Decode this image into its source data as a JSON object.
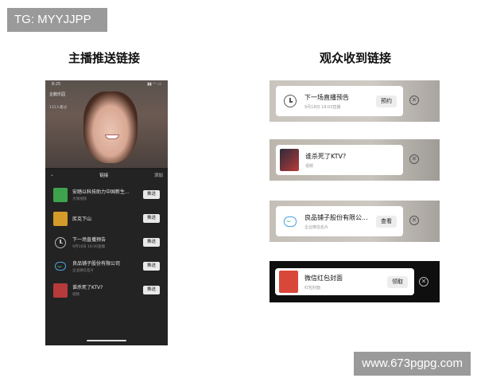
{
  "tag": "TG: MYYJJPP",
  "watermark": "www.673pgpg.com",
  "headings": {
    "left": "主播推送链接",
    "right": "观众收到链接"
  },
  "phone": {
    "status_time": "8:25",
    "stream_title": "企鹅乐园",
    "viewers": "131人看过",
    "sheet": {
      "title": "链接",
      "add": "添加",
      "items": [
        {
          "title": "安踏以科技助力中国新生...",
          "sub": "大咖视频",
          "button": "推送",
          "thumb_color": "#3fa34d"
        },
        {
          "title": "库克下山",
          "sub": "",
          "button": "推送",
          "thumb_color": "#d49a2a"
        },
        {
          "title": "下一场直播预告",
          "sub": "9月18日 18:00直播",
          "button": "推送",
          "icon": "clock-icon"
        },
        {
          "title": "良品铺子股份有限公司",
          "sub": "企业微信名片",
          "button": "推送",
          "icon": "chat-icon"
        },
        {
          "title": "谁杀死了KTV?",
          "sub": "视频",
          "button": "推送",
          "thumb_color": "#b83a3a"
        }
      ]
    }
  },
  "cards": [
    {
      "title": "下一场直播预告",
      "sub": "9月18日 18:00直播",
      "button": "预约",
      "icon": "clock-icon"
    },
    {
      "title": "谁杀死了KTV?",
      "sub": "视频",
      "button": "",
      "thumb_color": "#b83a3a"
    },
    {
      "title": "良品铺子股份有限公...",
      "sub": "企业微信名片",
      "button": "查看",
      "icon": "chat-icon"
    },
    {
      "title": "微信红包封面",
      "sub": "红包封面",
      "button": "领取",
      "thumb_color": "#d9463a"
    }
  ],
  "colors": {
    "sheet_bg": "#232323",
    "tag_bg": "#9a9a9a",
    "accent_red": "#d9463a"
  }
}
